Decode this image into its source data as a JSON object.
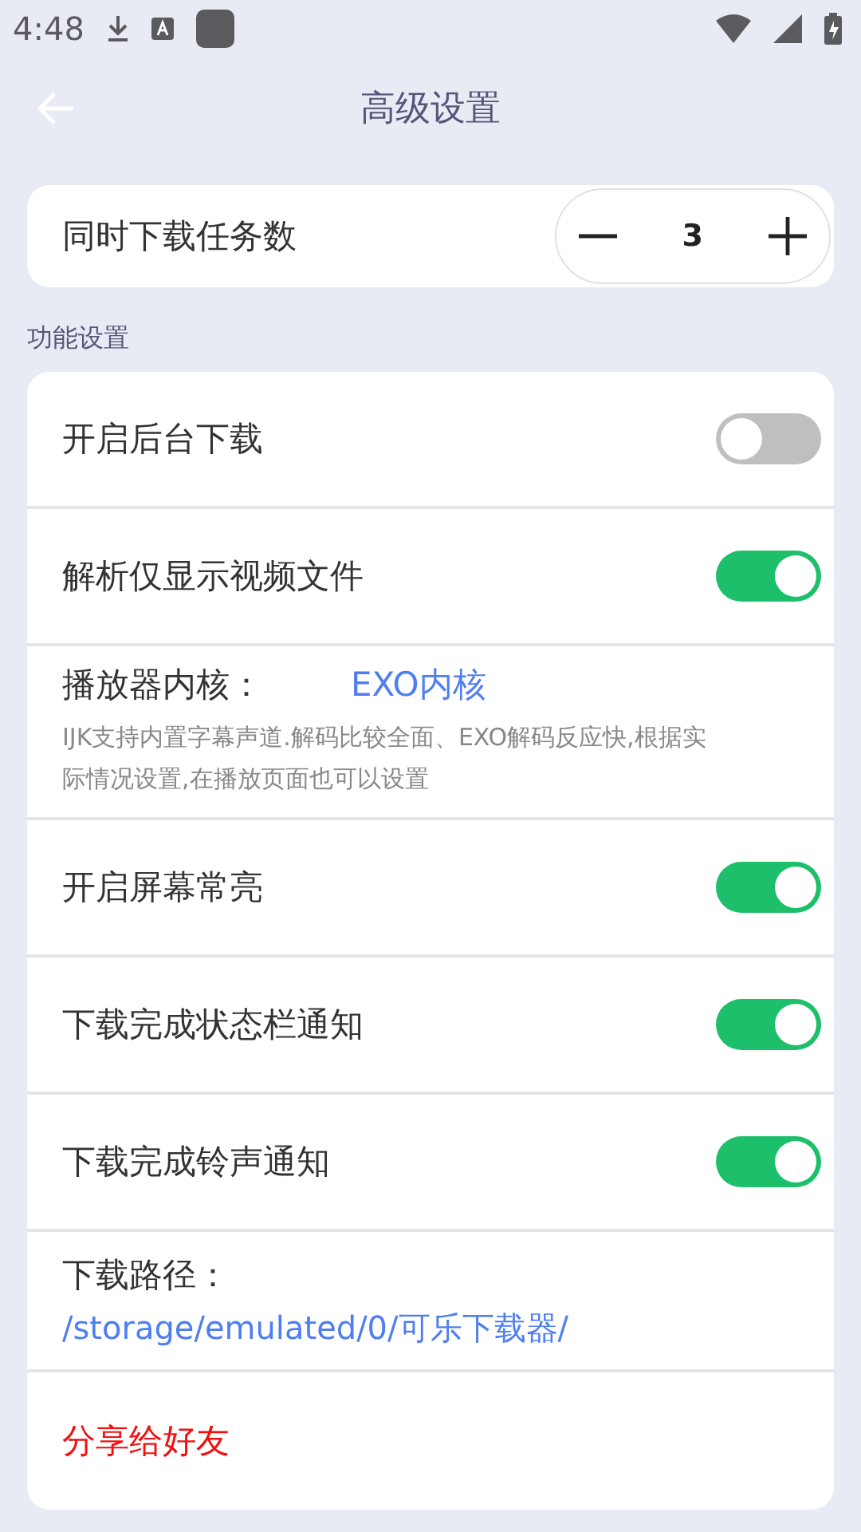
{
  "status_bar": {
    "time": "4:48"
  },
  "header": {
    "title": "高级设置"
  },
  "concurrent": {
    "label": "同时下载任务数",
    "value": "3"
  },
  "section_title": "功能设置",
  "rows": [
    {
      "kind": "toggle",
      "label": "开启后台下载",
      "on": false
    },
    {
      "kind": "toggle",
      "label": "解析仅显示视频文件",
      "on": true
    },
    {
      "kind": "player",
      "label": "播放器内核：",
      "value": "EXO内核",
      "description": "IJK支持内置字幕声道.解码比较全面、EXO解码反应快,根据实际情况设置,在播放页面也可以设置"
    },
    {
      "kind": "toggle",
      "label": "开启屏幕常亮",
      "on": true
    },
    {
      "kind": "toggle",
      "label": "下载完成状态栏通知",
      "on": true
    },
    {
      "kind": "toggle",
      "label": "下载完成铃声通知",
      "on": true
    },
    {
      "kind": "path",
      "label": "下载路径：",
      "value": "/storage/emulated/0/可乐下载器/"
    },
    {
      "kind": "share",
      "label": "分享给好友"
    }
  ]
}
